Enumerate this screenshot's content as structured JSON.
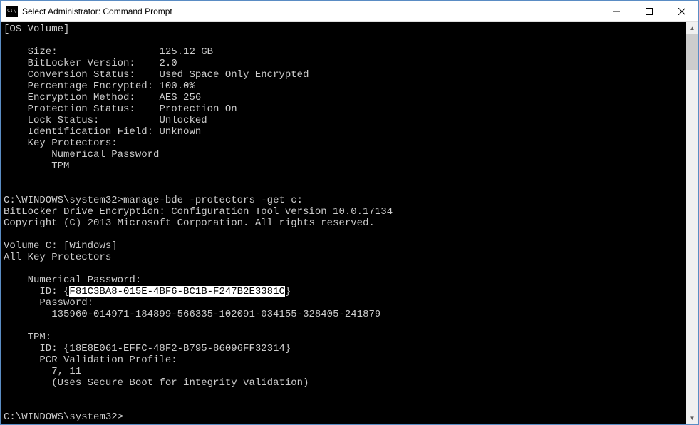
{
  "titlebar": {
    "title": "Select Administrator: Command Prompt"
  },
  "terminal": {
    "os_volume_header": "[OS Volume]",
    "size_label": "    Size:                 ",
    "size_value": "125.12 GB",
    "blv_label": "    BitLocker Version:    ",
    "blv_value": "2.0",
    "conv_label": "    Conversion Status:    ",
    "conv_value": "Used Space Only Encrypted",
    "pct_label": "    Percentage Encrypted: ",
    "pct_value": "100.0%",
    "enc_label": "    Encryption Method:    ",
    "enc_value": "AES 256",
    "prot_label": "    Protection Status:    ",
    "prot_value": "Protection On",
    "lock_label": "    Lock Status:          ",
    "lock_value": "Unlocked",
    "idf_label": "    Identification Field: ",
    "idf_value": "Unknown",
    "kp_label": "    Key Protectors:",
    "kp_np": "        Numerical Password",
    "kp_tpm": "        TPM",
    "prompt1_path": "C:\\WINDOWS\\system32>",
    "prompt1_cmd": "manage-bde -protectors -get c:",
    "tool_line": "BitLocker Drive Encryption: Configuration Tool version 10.0.17134",
    "copyright_line": "Copyright (C) 2013 Microsoft Corporation. All rights reserved.",
    "vol_line": "Volume C: [Windows]",
    "allkp_line": "All Key Protectors",
    "np_header": "    Numerical Password:",
    "np_id_prefix": "      ID: {",
    "np_id_highlight": "F81C3BA8-015E-4BF6-BC1B-F247B2E3381C",
    "np_id_suffix": "}",
    "np_pw_label": "      Password:",
    "np_pw_value": "        135960-014971-184899-566335-102091-034155-328405-241879",
    "tpm_header": "    TPM:",
    "tpm_id": "      ID: {18E8E061-EFFC-48F2-B795-86096FF32314}",
    "tpm_pcr_label": "      PCR Validation Profile:",
    "tpm_pcr_value": "        7, 11",
    "tpm_boot": "        (Uses Secure Boot for integrity validation)",
    "prompt2": "C:\\WINDOWS\\system32>"
  }
}
